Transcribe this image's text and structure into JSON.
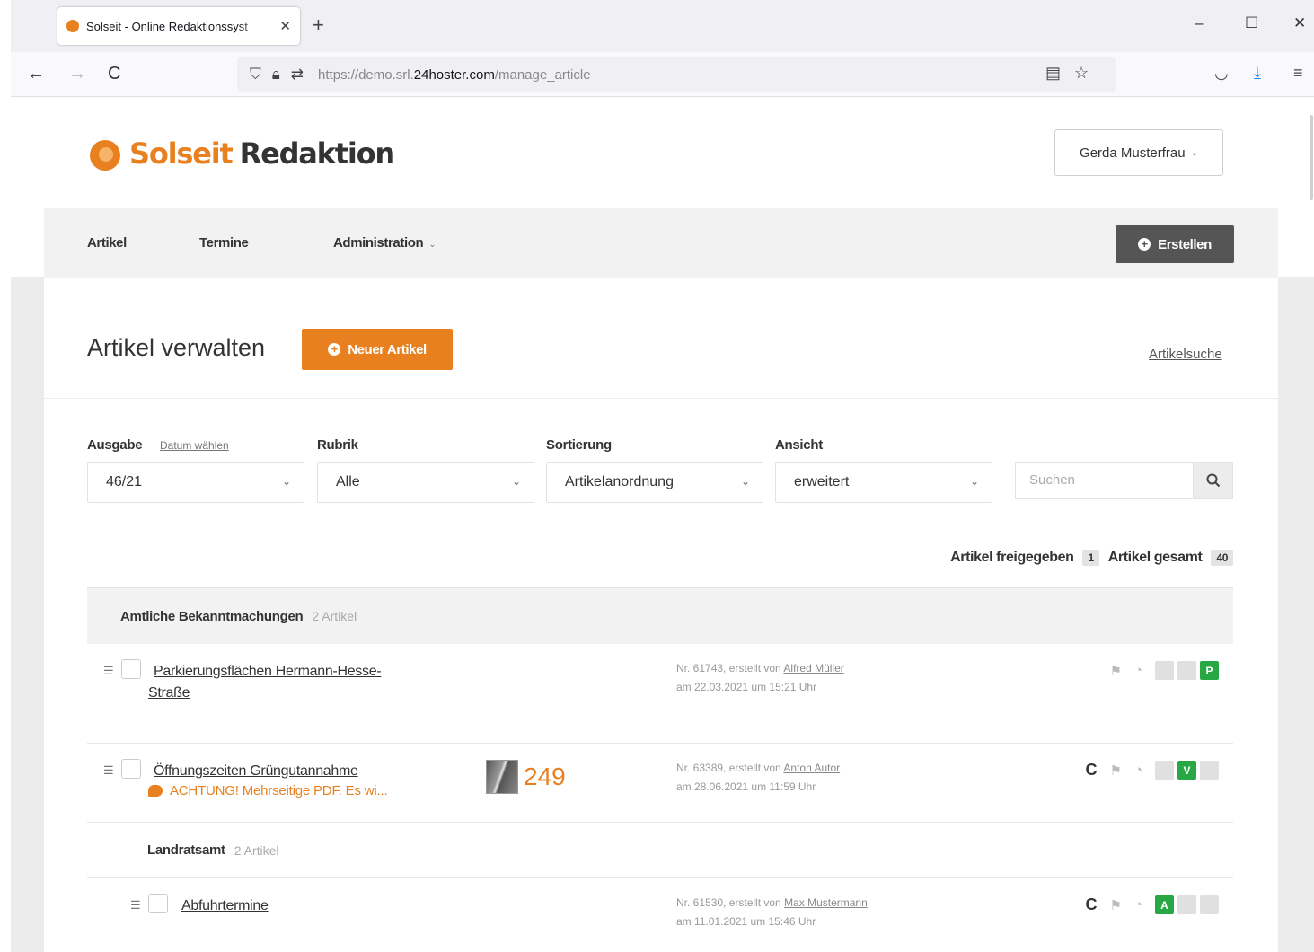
{
  "browser": {
    "tab_title": "Solseit - Online Redaktionssyst",
    "tab_close": "✕",
    "new_tab": "+",
    "url_prefix": "https://demo.srl.",
    "url_domain": "24hoster.com",
    "url_path": "/manage_article",
    "nav_back": "←",
    "nav_forward": "→",
    "nav_reload": "C",
    "win_minimize": "–",
    "win_maximize": "☐",
    "win_close": "✕",
    "icons": [
      "shield-icon",
      "lock-icon",
      "permissions-icon",
      "reader-icon",
      "bookmark-star-icon",
      "pocket-icon",
      "download-icon",
      "menu-icon"
    ]
  },
  "header": {
    "logo_brand": "Solseit",
    "logo_title": "Redaktion",
    "user_name": "Gerda Musterfrau"
  },
  "nav": {
    "items": [
      "Artikel",
      "Termine",
      "Administration"
    ],
    "create_label": "Erstellen"
  },
  "page": {
    "title": "Artikel verwalten",
    "new_article_label": "Neuer Artikel",
    "search_link": "Artikelsuche"
  },
  "filters": {
    "ausgabe_label": "Ausgabe",
    "ausgabe_link": "Datum wählen",
    "ausgabe_value": "46/21",
    "rubrik_label": "Rubrik",
    "rubrik_value": "Alle",
    "sortierung_label": "Sortierung",
    "sortierung_value": "Artikelanordnung",
    "ansicht_label": "Ansicht",
    "ansicht_value": "erweitert",
    "search_placeholder": "Suchen"
  },
  "counts": {
    "released_label": "Artikel freigegeben",
    "released_value": "1",
    "total_label": "Artikel gesamt",
    "total_value": "40"
  },
  "groups": [
    {
      "name": "Amtliche Bekanntmachungen",
      "count": "2 Artikel",
      "articles": [
        {
          "title_line1": "Parkierungsflächen Hermann-Hesse-",
          "title_line2": "Straße",
          "meta_prefix": "Nr. 61743, erstellt von ",
          "author": "Alfred Müller",
          "date": "am 22.03.2021 um 15:21 Uhr",
          "status": [
            "",
            "",
            "P"
          ],
          "status_active": [
            false,
            false,
            true
          ]
        },
        {
          "title": "Öffnungszeiten Grüngutannahme",
          "warning": "ACHTUNG! Mehrseitige PDF. Es wi...",
          "thumb_text": "249",
          "meta_prefix": "Nr. 63389, erstellt von ",
          "author": "Anton Autor",
          "date": "am 28.06.2021 um 11:59 Uhr",
          "status": [
            "",
            "V",
            ""
          ],
          "status_active": [
            false,
            true,
            false
          ]
        }
      ]
    },
    {
      "name": "Landratsamt",
      "count": "2 Artikel",
      "articles": [
        {
          "title": "Abfuhrtermine",
          "meta_prefix": "Nr. 61530, erstellt von ",
          "author": "Max Mustermann",
          "date": "am 11.01.2021 um 15:46 Uhr",
          "status": [
            "A",
            "",
            ""
          ],
          "status_active": [
            true,
            false,
            false
          ]
        }
      ]
    }
  ],
  "colors": {
    "brand_orange": "#e8801f",
    "status_green": "#27a844",
    "dark_button": "#555555"
  }
}
